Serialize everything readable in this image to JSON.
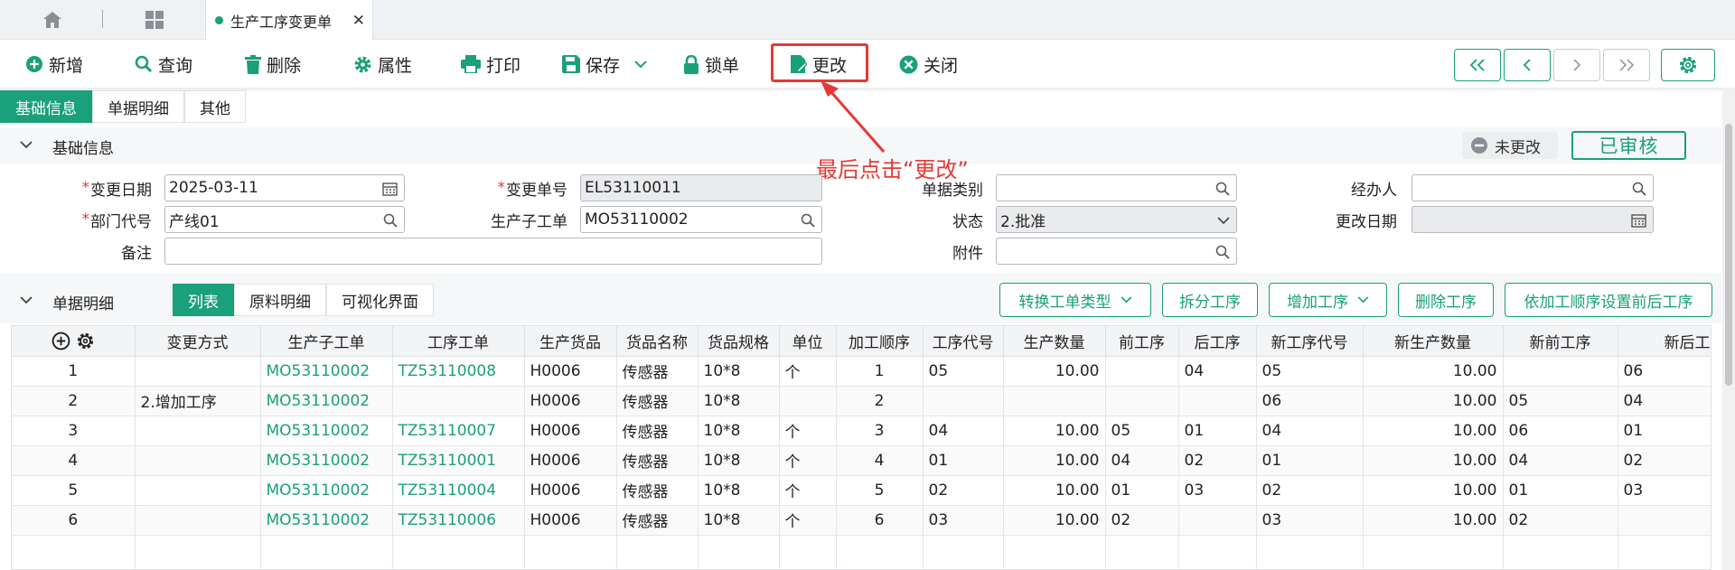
{
  "tab": {
    "title": "生产工序变更单"
  },
  "toolbar": {
    "add": "新增",
    "query": "查询",
    "delete": "删除",
    "properties": "属性",
    "print": "打印",
    "save": "保存",
    "lock": "锁单",
    "change": "更改",
    "close": "关闭"
  },
  "subtabs": [
    "基础信息",
    "单据明细",
    "其他"
  ],
  "basic": {
    "title": "基础信息",
    "status_badge": "未更改",
    "approved_label": "已审核",
    "annotation": "最后点击“更改”",
    "fields": {
      "change_date": {
        "label": "变更日期",
        "value": "2025-03-11"
      },
      "change_no": {
        "label": "变更单号",
        "value": "EL53110011"
      },
      "doc_type": {
        "label": "单据类别",
        "value": ""
      },
      "handler": {
        "label": "经办人",
        "value": ""
      },
      "dept_code": {
        "label": "部门代号",
        "value": "产线01"
      },
      "sub_order": {
        "label": "生产子工单",
        "value": "MO53110002"
      },
      "status": {
        "label": "状态",
        "value": "2.批准"
      },
      "modify_date": {
        "label": "更改日期",
        "value": ""
      },
      "remark": {
        "label": "备注",
        "value": ""
      },
      "attachment": {
        "label": "附件",
        "value": ""
      }
    }
  },
  "detail": {
    "title": "单据明细",
    "tabs": [
      "列表",
      "原料明细",
      "可视化界面"
    ],
    "actions": {
      "convert": "转换工单类型",
      "split": "拆分工序",
      "add_proc": "增加工序",
      "delete_proc": "删除工序",
      "set_order": "依加工顺序设置前后工序"
    },
    "columns": [
      "变更方式",
      "生产子工单",
      "工序工单",
      "生产货品",
      "货品名称",
      "货品规格",
      "单位",
      "加工顺序",
      "工序代号",
      "生产数量",
      "前工序",
      "后工序",
      "新工序代号",
      "新生产数量",
      "新前工序",
      "新后工"
    ],
    "rows": [
      {
        "no": "1",
        "mode": "",
        "sub_order": "MO53110002",
        "proc_order": "TZ53110008",
        "goods": "H0006",
        "name": "传感器",
        "spec": "10*8",
        "unit": "个",
        "seq": "1",
        "proc_code": "05",
        "qty": "10.00",
        "prev": "",
        "next": "04",
        "new_code": "05",
        "new_qty": "10.00",
        "new_prev": "",
        "new_next": "06"
      },
      {
        "no": "2",
        "mode": "2.增加工序",
        "sub_order": "MO53110002",
        "proc_order": "",
        "goods": "H0006",
        "name": "传感器",
        "spec": "10*8",
        "unit": "",
        "seq": "2",
        "proc_code": "",
        "qty": "",
        "prev": "",
        "next": "",
        "new_code": "06",
        "new_qty": "10.00",
        "new_prev": "05",
        "new_next": "04"
      },
      {
        "no": "3",
        "mode": "",
        "sub_order": "MO53110002",
        "proc_order": "TZ53110007",
        "goods": "H0006",
        "name": "传感器",
        "spec": "10*8",
        "unit": "个",
        "seq": "3",
        "proc_code": "04",
        "qty": "10.00",
        "prev": "05",
        "next": "01",
        "new_code": "04",
        "new_qty": "10.00",
        "new_prev": "06",
        "new_next": "01"
      },
      {
        "no": "4",
        "mode": "",
        "sub_order": "MO53110002",
        "proc_order": "TZ53110001",
        "goods": "H0006",
        "name": "传感器",
        "spec": "10*8",
        "unit": "个",
        "seq": "4",
        "proc_code": "01",
        "qty": "10.00",
        "prev": "04",
        "next": "02",
        "new_code": "01",
        "new_qty": "10.00",
        "new_prev": "04",
        "new_next": "02"
      },
      {
        "no": "5",
        "mode": "",
        "sub_order": "MO53110002",
        "proc_order": "TZ53110004",
        "goods": "H0006",
        "name": "传感器",
        "spec": "10*8",
        "unit": "个",
        "seq": "5",
        "proc_code": "02",
        "qty": "10.00",
        "prev": "01",
        "next": "03",
        "new_code": "02",
        "new_qty": "10.00",
        "new_prev": "01",
        "new_next": "03"
      },
      {
        "no": "6",
        "mode": "",
        "sub_order": "MO53110002",
        "proc_order": "TZ53110006",
        "goods": "H0006",
        "name": "传感器",
        "spec": "10*8",
        "unit": "个",
        "seq": "6",
        "proc_code": "03",
        "qty": "10.00",
        "prev": "02",
        "next": "",
        "new_code": "03",
        "new_qty": "10.00",
        "new_prev": "02",
        "new_next": ""
      }
    ]
  },
  "colors": {
    "accent": "#1aa07a",
    "highlight": "#e53935"
  }
}
